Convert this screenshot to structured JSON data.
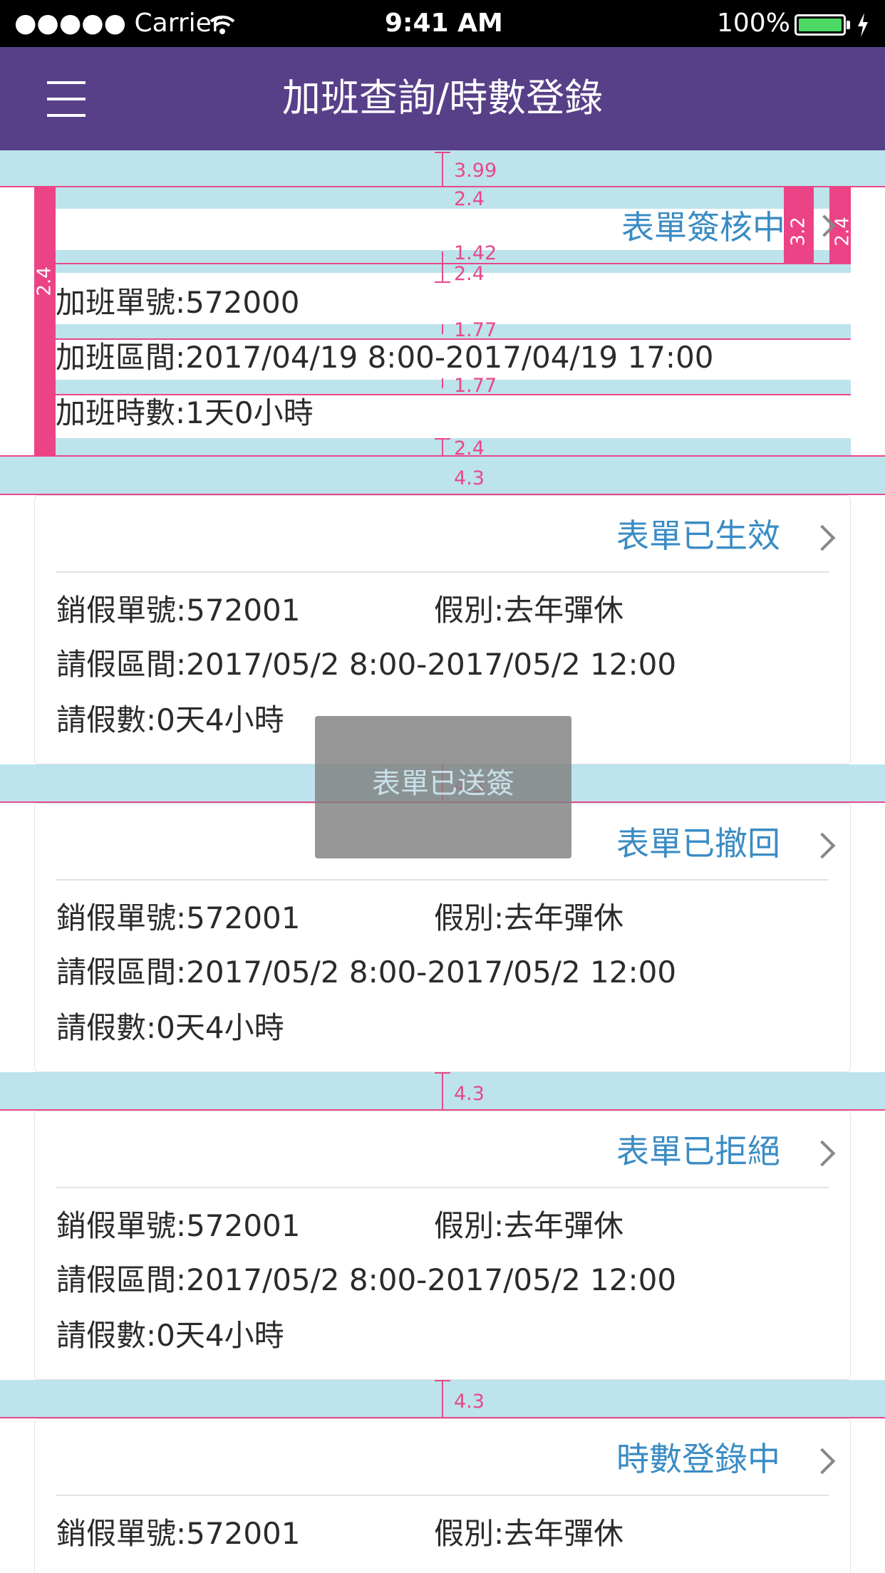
{
  "status_bar": {
    "carrier": "●●●●● Carrier",
    "time": "9:41 AM",
    "battery_percent": "100%",
    "battery_level": 1.0
  },
  "nav": {
    "title": "加班查詢/時數登錄",
    "menu_icon": "hamburger-menu-icon"
  },
  "spec_labels": {
    "top_gap": "3.99",
    "pad_a": "2.4",
    "pad_b": "1.42",
    "pad_c": "2.4",
    "line_gap_1": "1.77",
    "line_gap_2": "1.77",
    "pad_bottom": "2.4",
    "card_gap": "4.3",
    "left_bar": "2.4",
    "chev_gap": "3.2",
    "right_bar": "2.4"
  },
  "overtime_card": {
    "status": "表單簽核中",
    "form_no": "加班單號:572000",
    "period": "加班區間:2017/04/19 8:00-2017/04/19 17:00",
    "hours": "加班時數:1天0小時"
  },
  "leave_cards": [
    {
      "status": "表單已生效",
      "form_no": "銷假單號:572001",
      "leave_type": "假別:去年彈休",
      "period": "請假區間:2017/05/2 8:00-2017/05/2 12:00",
      "count": "請假數:0天4小時"
    },
    {
      "status": "表單已撤回",
      "form_no": "銷假單號:572001",
      "leave_type": "假別:去年彈休",
      "period": "請假區間:2017/05/2 8:00-2017/05/2 12:00",
      "count": "請假數:0天4小時"
    },
    {
      "status": "表單已拒絕",
      "form_no": "銷假單號:572001",
      "leave_type": "假別:去年彈休",
      "period": "請假區間:2017/05/2 8:00-2017/05/2 12:00",
      "count": "請假數:0天4小時"
    },
    {
      "status": "時數登錄中",
      "form_no": "銷假單號:572001",
      "leave_type": "假別:去年彈休"
    }
  ],
  "toast": {
    "text": "表單已送簽"
  },
  "colors": {
    "nav_bg": "#574088",
    "status_blue": "#3a8cc4",
    "spec_pink": "#e8488a",
    "spec_band": "#bde3ec",
    "battery_green": "#4cd964"
  }
}
